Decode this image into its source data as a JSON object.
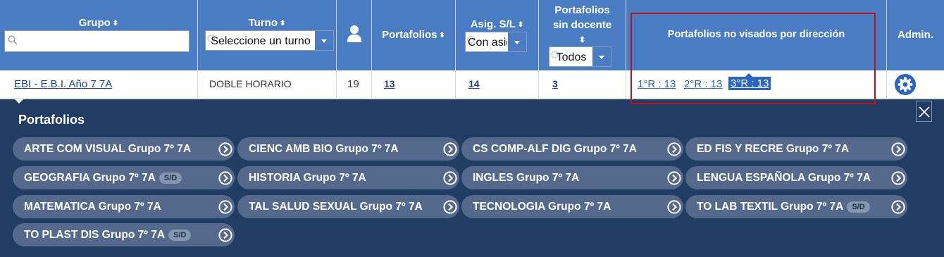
{
  "header": {
    "grupo": "Grupo",
    "grupo_search_placeholder": "",
    "turno": "Turno",
    "turno_select_value": "Seleccione un turno",
    "portafolios": "Portafolios",
    "asig_sl": "Asig. S/L",
    "asig_select_value": "Con asig",
    "portafolios_sin_docente_1": "Portafolios",
    "portafolios_sin_docente_2": "sin docente",
    "sin_docente_select_value": "Todos",
    "no_visados": "Portafolios no visados por dirección",
    "admin": "Admin.",
    "sort_glyph": "⬍",
    "user_icon": "user-icon"
  },
  "row": {
    "grupo": "EBI - E.B.I. Año 7 7A",
    "turno": "DOBLE HORARIO",
    "alumnos": "19",
    "portafolios": "13",
    "asig": "14",
    "sin_docente": "3",
    "no_visados": [
      "1°R : 13",
      "2°R : 13",
      "3°R : 13"
    ],
    "admin_icon": "gear-icon"
  },
  "panel": {
    "title": "Portafolios",
    "close_icon": "close-icon",
    "sd_label": "S/D",
    "items": [
      {
        "label": "ARTE COM VISUAL Grupo 7º 7A",
        "sd": false
      },
      {
        "label": "CIENC AMB BIO Grupo 7º 7A",
        "sd": false
      },
      {
        "label": "CS COMP-ALF DIG Grupo 7º 7A",
        "sd": false
      },
      {
        "label": "ED FIS Y RECRE Grupo 7º 7A",
        "sd": false
      },
      {
        "label": "GEOGRAFIA Grupo 7º 7A",
        "sd": true
      },
      {
        "label": "HISTORIA Grupo 7º 7A",
        "sd": false
      },
      {
        "label": "INGLES Grupo 7º 7A",
        "sd": false
      },
      {
        "label": "LENGUA ESPAÑOLA Grupo 7º 7A",
        "sd": false
      },
      {
        "label": "MATEMATICA Grupo 7º 7A",
        "sd": false
      },
      {
        "label": "TAL SALUD SEXUAL Grupo 7º 7A",
        "sd": false
      },
      {
        "label": "TECNOLOGIA Grupo 7º 7A",
        "sd": false
      },
      {
        "label": "TO LAB TEXTIL Grupo 7º 7A",
        "sd": true
      },
      {
        "label": "TO PLAST DIS Grupo 7º 7A",
        "sd": true
      }
    ]
  },
  "colors": {
    "header_bg": "#4a7cc4",
    "panel_bg": "#223d63",
    "pill_bg": "#54698c",
    "highlight": "#c0121e",
    "link": "#1f3f8a"
  }
}
